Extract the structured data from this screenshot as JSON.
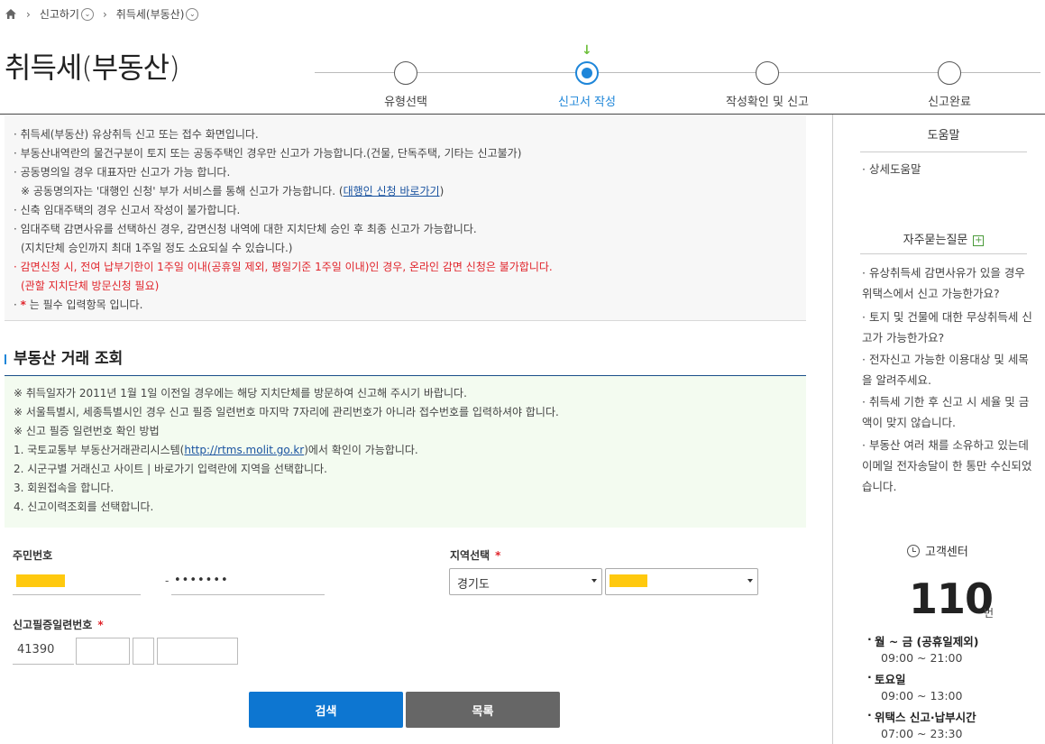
{
  "breadcrumb": {
    "items": [
      "신고하기",
      "취득세(부동산)"
    ]
  },
  "page_title": "취득세(부동산)",
  "steps": [
    {
      "label": "유형선택",
      "active": false
    },
    {
      "label": "신고서 작성",
      "active": true
    },
    {
      "label": "작성확인 및 신고",
      "active": false
    },
    {
      "label": "신고완료",
      "active": false
    }
  ],
  "notices": {
    "l1": "· 취득세(부동산) 유상취득 신고 또는 접수 화면입니다.",
    "l2": "· 부동산내역란의 물건구분이 토지 또는 공동주택인 경우만 신고가 가능합니다.(건물, 단독주택, 기타는 신고불가)",
    "l3": "· 공동명의일 경우 대표자만 신고가 가능 합니다.",
    "l4_prefix": "※ 공동명의자는 '대행인 신청' 부가 서비스를 통해 신고가 가능합니다. (",
    "l4_link": "대행인 신청 바로가기",
    "l4_suffix": ")",
    "l5": "· 신축 임대주택의 경우 신고서 작성이 불가합니다.",
    "l6": "· 임대주택 감면사유를 선택하신 경우, 감면신청 내역에 대한 지치단체 승인 후 최종 신고가 가능합니다.",
    "l7": "(지치단체 승인까지 최대 1주일 정도 소요되실 수 있습니다.)",
    "l8": "· 감면신청 시, 전여 납부기한이 1주일 이내(공휴일 제외, 평일기준 1주일 이내)인 경우, 온라인 감면 신청은 불가합니다.",
    "l9": "(관할 지치단체 방문신청 필요)",
    "l10_prefix": "· ",
    "l10_star": "*",
    "l10_suffix": " 는 필수 입력항목 입니다."
  },
  "section": {
    "title": "부동산 거래 조회",
    "info": {
      "l1": "※ 취득일자가 2011년 1월 1일 이전일 경우에는 해당 지치단체를 방문하여 신고해 주시기 바랍니다.",
      "l2": "※ 서울특별시, 세종특별시인 경우 신고 필증 일련번호 마지막 7자리에 관리번호가 아니라 접수번호를 입력하셔야 합니다.",
      "l3": "※ 신고 필증 일련번호 확인 방법",
      "l4_prefix": "1. 국토교통부 부동산거래관리시스템(",
      "l4_link": "http://rtms.molit.go.kr",
      "l4_suffix": ")에서 확인이 가능합니다.",
      "l5": "2. 시군구별 거래신고 사이트 | 바로가기 입력란에 지역을 선택합니다.",
      "l6": "3. 회원접속을 합니다.",
      "l7": "4. 신고이력조회를 선택합니다."
    }
  },
  "form": {
    "resident_label": "주민번호",
    "resident_back": "•••••••",
    "resident_dash": "-",
    "region_label": "지역선택",
    "region_value": "경기도",
    "serial_label": "신고필증일련번호",
    "serial_prefix": "41390",
    "required_star": "*"
  },
  "buttons": {
    "search": "검색",
    "list": "목록"
  },
  "sidebar": {
    "help_title": "도움말",
    "help_item": "· 상세도움말",
    "faq_title": "자주묻는질문",
    "faq_plus": "+",
    "faq": [
      "· 유상취득세 감면사유가 있을 경우 위택스에서 신고 가능한가요?",
      "· 토지 및 건물에 대한 무상취득세 신고가 가능한가요?",
      "· 전자신고 가능한 이용대상 및 세목을 알려주세요.",
      "· 취득세 기한 후 신고 시 세율 및 금액이 맞지 않습니다.",
      "· 부동산 여러 채를 소유하고 있는데 이메일 전자송달이 한 통만 수신되었습니다."
    ],
    "cc_title": "고객센터",
    "cc_number": "110",
    "cc_unit": "번",
    "hours": [
      {
        "title": "월 ~ 금 (공휴일제외)",
        "value": "09:00 ~ 21:00"
      },
      {
        "title": "토요일",
        "value": "09:00 ~ 13:00"
      },
      {
        "title": "위택스 신고·납부시간",
        "value": "07:00 ~ 23:30"
      }
    ]
  },
  "colors": {
    "accent": "#1e86d9",
    "warning": "#e0242b",
    "mask": "#ffc90e",
    "button_primary": "#0d76d1",
    "button_secondary": "#666666"
  },
  "icons": [
    "home-icon",
    "chevron-down-icon",
    "clock-icon",
    "plus-icon",
    "arrow-down-icon"
  ]
}
